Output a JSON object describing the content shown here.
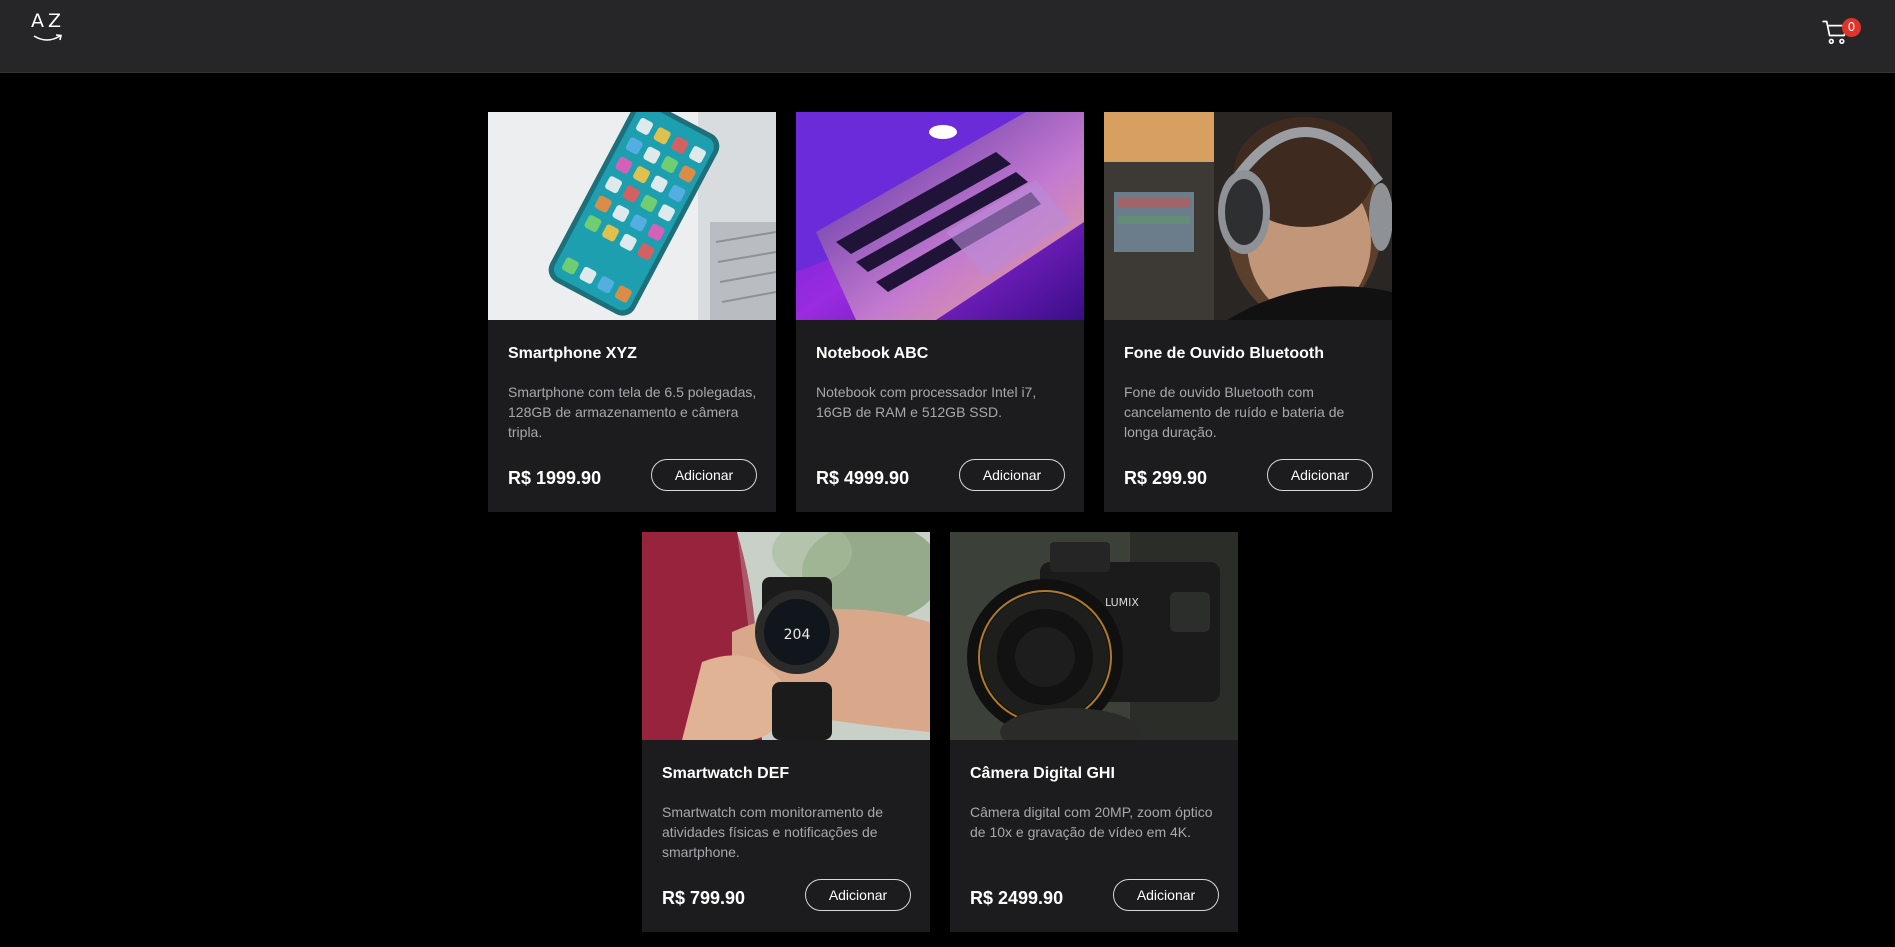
{
  "header": {
    "logo_text": "AZ",
    "cart_count": "0",
    "badge_color": "#e0342b"
  },
  "products": [
    {
      "title": "Smartphone XYZ",
      "description": "Smartphone com tela de 6.5 polegadas, 128GB de armazenamento e câmera tripla.",
      "price": "R$ 1999.90",
      "button_label": "Adicionar"
    },
    {
      "title": "Notebook ABC",
      "description": "Notebook com processador Intel i7, 16GB de RAM e 512GB SSD.",
      "price": "R$ 4999.90",
      "button_label": "Adicionar"
    },
    {
      "title": "Fone de Ouvido Bluetooth",
      "description": "Fone de ouvido Bluetooth com cancelamento de ruído e bateria de longa duração.",
      "price": "R$ 299.90",
      "button_label": "Adicionar"
    },
    {
      "title": "Smartwatch DEF",
      "description": "Smartwatch com monitoramento de atividades físicas e notificações de smartphone.",
      "price": "R$ 799.90",
      "button_label": "Adicionar"
    },
    {
      "title": "Câmera Digital GHI",
      "description": "Câmera digital com 20MP, zoom óptico de 10x e gravação de vídeo em 4K.",
      "price": "R$ 2499.90",
      "button_label": "Adicionar"
    }
  ]
}
